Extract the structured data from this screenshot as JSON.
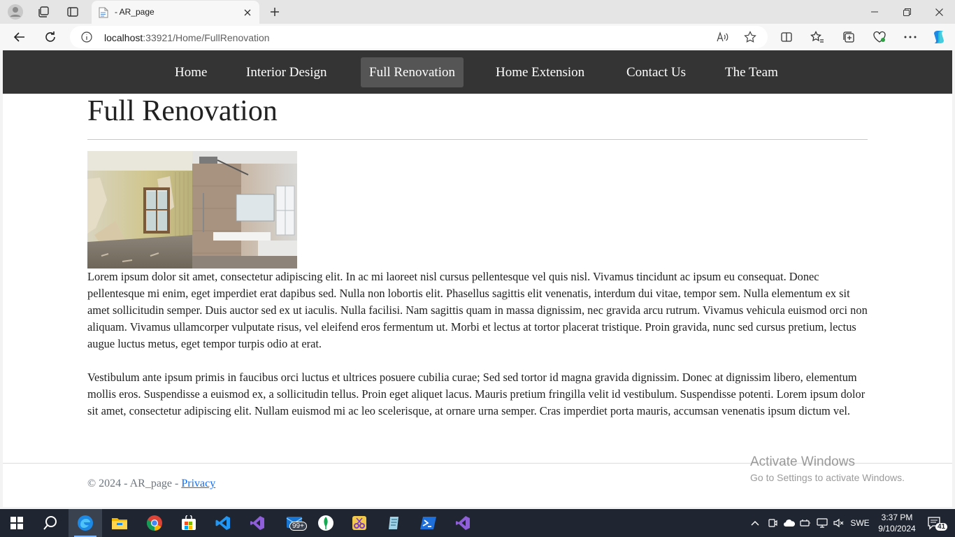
{
  "browser": {
    "tab_title": "- AR_page",
    "url_host": "localhost",
    "url_rest": ":33921/Home/FullRenovation"
  },
  "nav": {
    "items": [
      {
        "label": "Home"
      },
      {
        "label": "Interior Design"
      },
      {
        "label": "Full Renovation",
        "active": true
      },
      {
        "label": "Home Extension"
      },
      {
        "label": "Contact Us"
      },
      {
        "label": "The Team"
      }
    ]
  },
  "main": {
    "title": "Full Renovation",
    "paragraph1": "Lorem ipsum dolor sit amet, consectetur adipiscing elit. In ac mi laoreet nisl cursus pellentesque vel quis nisl. Vivamus tincidunt ac ipsum eu consequat. Donec pellentesque mi enim, eget imperdiet erat dapibus sed. Nulla non lobortis elit. Phasellus sagittis elit venenatis, interdum dui vitae, tempor sem. Nulla elementum ex sit amet sollicitudin semper. Duis auctor sed ex ut iaculis. Nulla facilisi. Nam sagittis quam in massa dignissim, nec gravida arcu rutrum. Vivamus vehicula euismod orci non aliquam. Vivamus ullamcorper vulputate risus, vel eleifend eros fermentum ut. Morbi et lectus at tortor placerat tristique. Proin gravida, nunc sed cursus pretium, lectus augue luctus metus, eget tempor turpis odio at erat.",
    "paragraph2": "Vestibulum ante ipsum primis in faucibus orci luctus et ultrices posuere cubilia curae; Sed sed tortor id magna gravida dignissim. Donec at dignissim libero, elementum mollis eros. Suspendisse a euismod ex, a sollicitudin tellus. Proin eget aliquet lacus. Mauris pretium fringilla velit id vestibulum. Suspendisse potenti. Lorem ipsum dolor sit amet, consectetur adipiscing elit. Nullam euismod mi ac leo scelerisque, at ornare urna semper. Cras imperdiet porta mauris, accumsan venenatis ipsum dictum vel."
  },
  "footer": {
    "copyright": "© 2024 - AR_page - ",
    "privacy_link": "Privacy"
  },
  "watermark": {
    "line1": "Activate Windows",
    "line2": "Go to Settings to activate Windows."
  },
  "taskbar": {
    "mail_badge": "99+",
    "language": "SWE",
    "time": "3:37 PM",
    "date": "9/10/2024",
    "notification_count": "41"
  },
  "colors": {
    "nav_background": "#343434",
    "nav_active": "#555555",
    "link": "#0d6efd",
    "taskbar": "#1f2631"
  }
}
